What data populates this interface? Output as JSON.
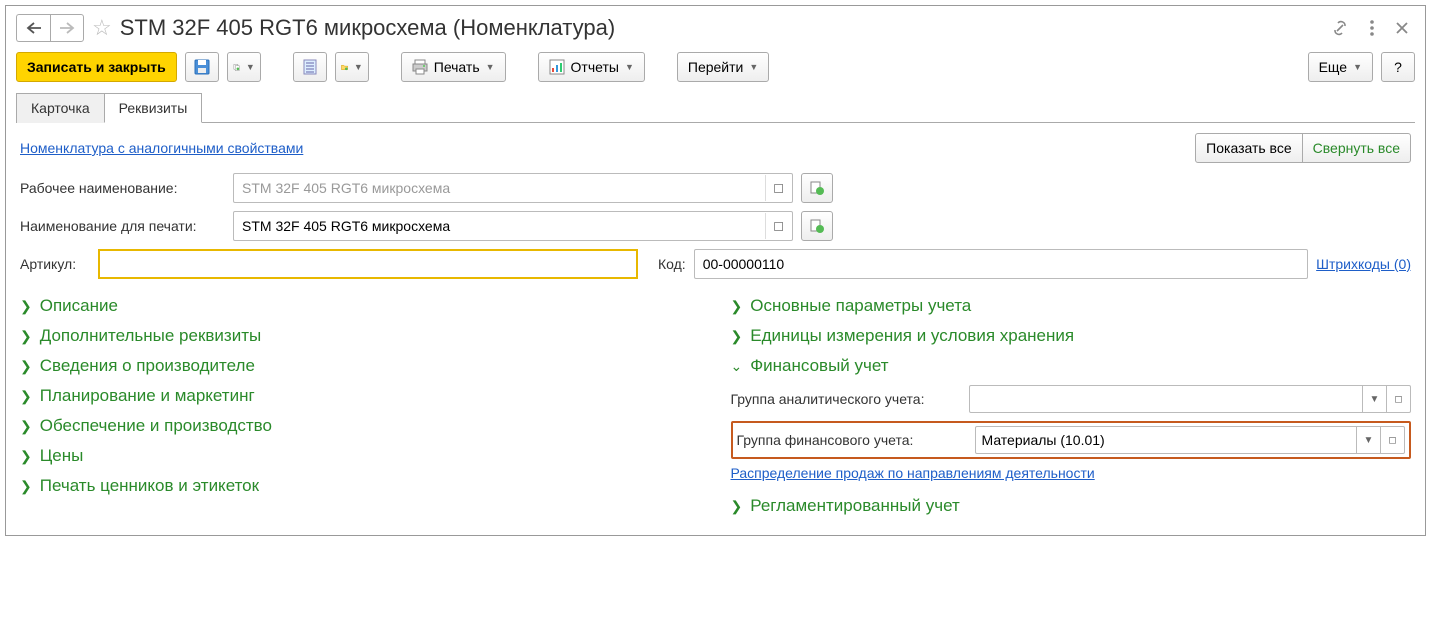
{
  "header": {
    "title": "STM 32F 405 RGT6 микросхема (Номенклатура)"
  },
  "toolbar": {
    "save_close": "Записать и закрыть",
    "print": "Печать",
    "reports": "Отчеты",
    "goto": "Перейти",
    "more": "Еще",
    "help": "?"
  },
  "tabs": {
    "card": "Карточка",
    "details": "Реквизиты"
  },
  "links": {
    "similar": "Номенклатура с аналогичными свойствами",
    "show_all": "Показать все",
    "collapse_all": "Свернуть все",
    "barcodes": "Штрихкоды (0)",
    "sales_dist": "Распределение продаж по направлениям деятельности"
  },
  "form": {
    "working_name_label": "Рабочее наименование:",
    "working_name_value": "STM 32F 405 RGT6 микросхема",
    "print_name_label": "Наименование для печати:",
    "print_name_value": "STM 32F 405 RGT6 микросхема",
    "artikul_label": "Артикул:",
    "artikul_value": "",
    "code_label": "Код:",
    "code_value": "00-00000110"
  },
  "sections_left": {
    "description": "Описание",
    "additional": "Дополнительные реквизиты",
    "manufacturer": "Сведения о производителе",
    "planning": "Планирование и маркетинг",
    "supply": "Обеспечение и производство",
    "prices": "Цены",
    "print_tags": "Печать ценников и этикеток"
  },
  "sections_right": {
    "main_params": "Основные параметры учета",
    "units": "Единицы измерения и условия хранения",
    "finance": "Финансовый учет",
    "analytical_group_label": "Группа аналитического учета:",
    "analytical_group_value": "",
    "finance_group_label": "Группа финансового учета:",
    "finance_group_value": "Материалы (10.01)",
    "regulated": "Регламентированный учет"
  }
}
